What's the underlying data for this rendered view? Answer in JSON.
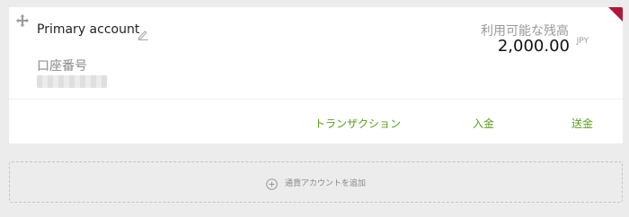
{
  "account": {
    "name": "Primary account",
    "number_label": "口座番号",
    "balance_label": "利用可能な残高",
    "balance_amount": "2,000.00",
    "currency": "JPY"
  },
  "actions": {
    "transactions": "トランザクション",
    "deposit": "入金",
    "send": "送金"
  },
  "add_account": {
    "label": "通貨アカウントを追加"
  },
  "colors": {
    "accent": "#5a9e1f",
    "flag": "#b0173a"
  }
}
